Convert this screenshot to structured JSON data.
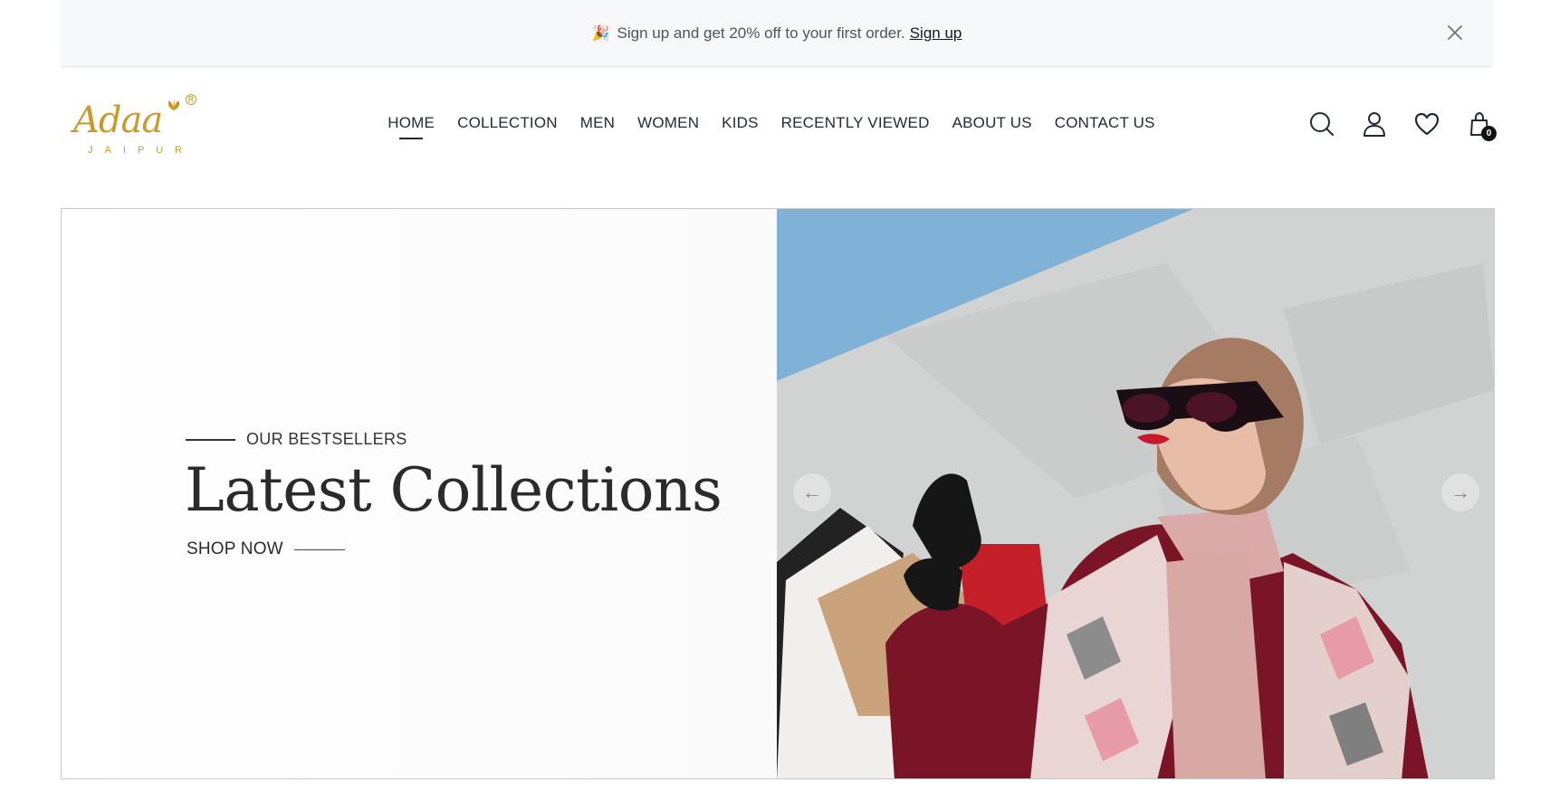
{
  "announcement": {
    "emoji": "🎉",
    "text": "Sign up and get 20% off to your first order.",
    "link_label": "Sign up"
  },
  "brand": {
    "script": "Adaa",
    "sub": "JAIPUR",
    "registered": "R",
    "color": "#c99a2e"
  },
  "nav": {
    "items": [
      {
        "label": "HOME",
        "active": true
      },
      {
        "label": "COLLECTION"
      },
      {
        "label": "MEN"
      },
      {
        "label": "WOMEN"
      },
      {
        "label": "KIDS"
      },
      {
        "label": "RECENTLY VIEWED"
      },
      {
        "label": "ABOUT US"
      },
      {
        "label": "CONTACT US"
      }
    ]
  },
  "header_icons": {
    "search": "search-icon",
    "account": "account-icon",
    "wishlist": "heart-icon",
    "cart": "bag-icon",
    "cart_count": "0"
  },
  "hero": {
    "eyebrow": "OUR BESTSELLERS",
    "title": "Latest Collections",
    "cta": "SHOP NOW",
    "prev": "←",
    "next": "→"
  }
}
